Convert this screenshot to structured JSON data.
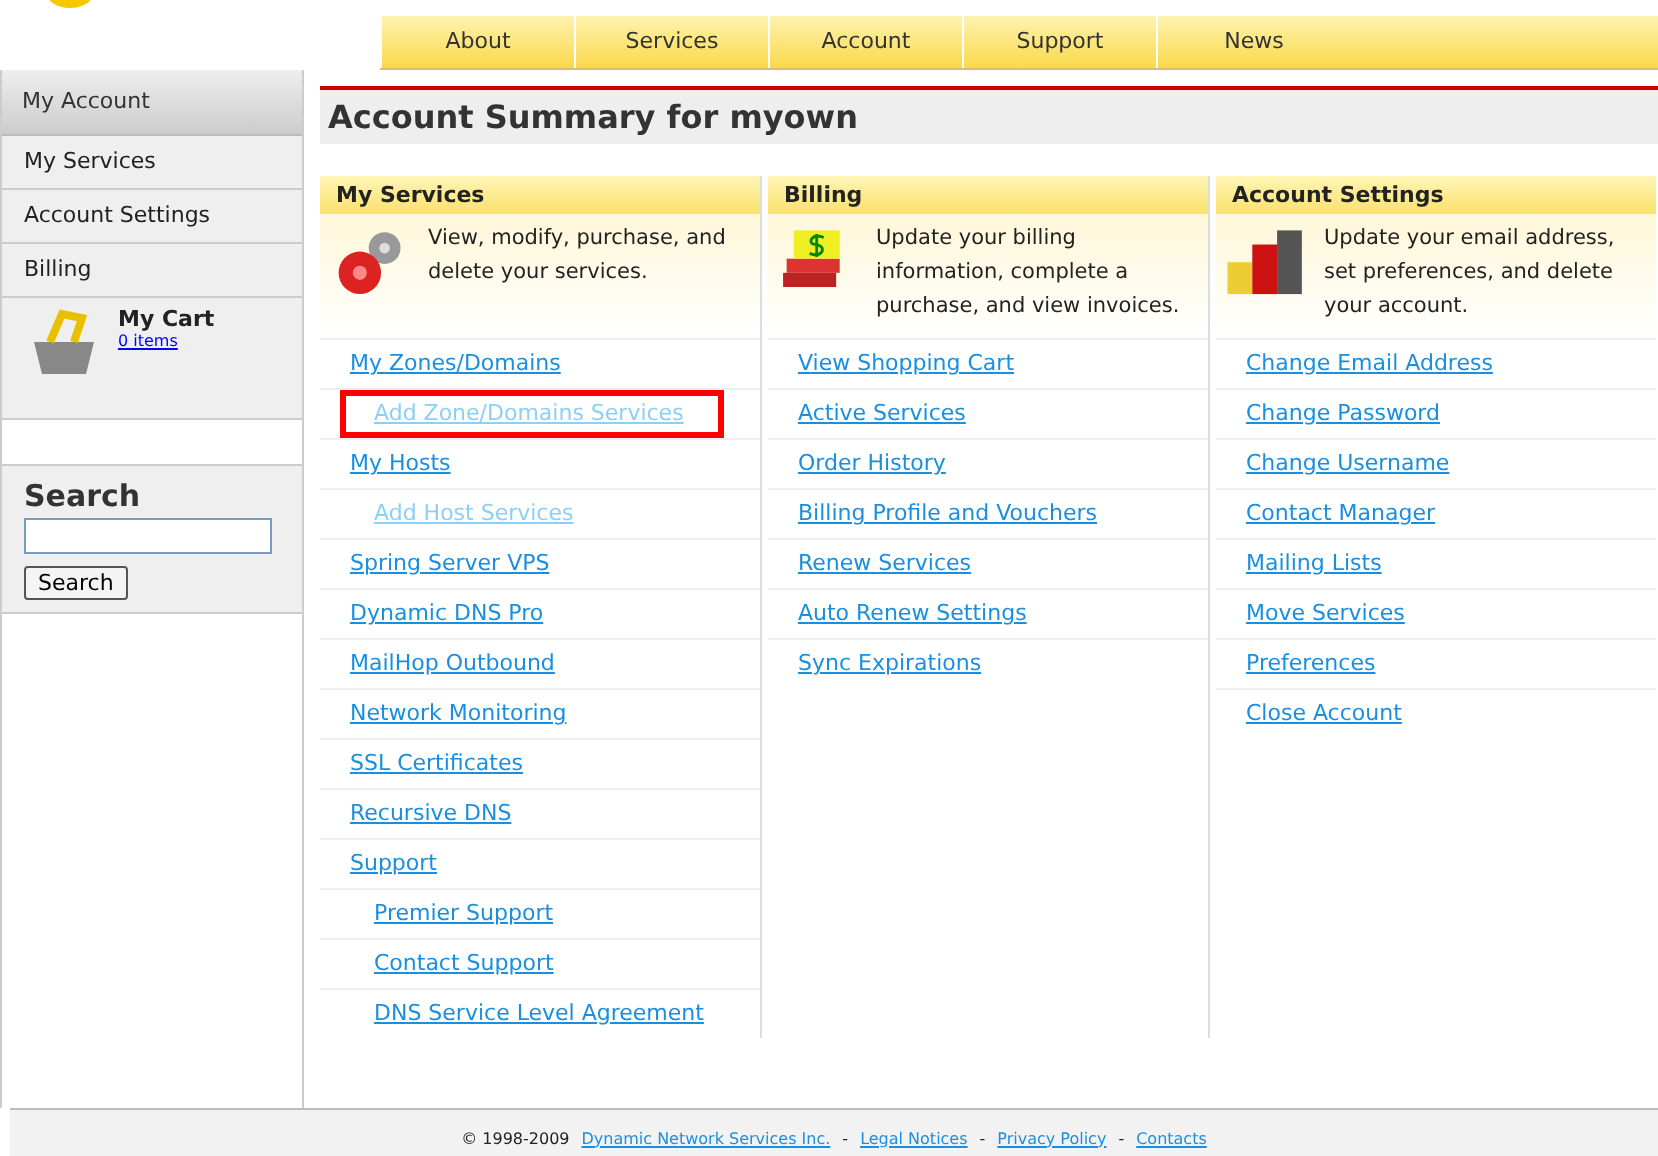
{
  "nav": {
    "items": [
      {
        "label": "About"
      },
      {
        "label": "Services"
      },
      {
        "label": "Account"
      },
      {
        "label": "Support"
      },
      {
        "label": "News"
      }
    ]
  },
  "sidebar": {
    "header": "My Account",
    "items": [
      {
        "label": "My Services"
      },
      {
        "label": "Account Settings"
      },
      {
        "label": "Billing"
      }
    ],
    "cart": {
      "title": "My Cart",
      "link": "0 items"
    }
  },
  "search": {
    "title": "Search",
    "button": "Search"
  },
  "page_title": "Account Summary for myown",
  "panels": [
    {
      "kind": "gears",
      "title": "My Services",
      "description": "View, modify, purchase, and delete your services.",
      "links": [
        {
          "label": "My Zones/Domains",
          "disabled": false,
          "children": [
            {
              "label": "Add Zone/Domains Services",
              "disabled": true,
              "highlighted": true
            }
          ]
        },
        {
          "label": "My Hosts",
          "disabled": false,
          "children": [
            {
              "label": "Add Host Services",
              "disabled": true
            }
          ]
        },
        {
          "label": "Spring Server VPS",
          "disabled": false
        },
        {
          "label": "Dynamic DNS Pro",
          "disabled": false
        },
        {
          "label": "MailHop Outbound",
          "disabled": false
        },
        {
          "label": "Network Monitoring",
          "disabled": false
        },
        {
          "label": "SSL Certificates",
          "disabled": false
        },
        {
          "label": "Recursive DNS",
          "disabled": false
        },
        {
          "label": "Support",
          "disabled": false,
          "children": [
            {
              "label": "Premier Support",
              "disabled": false
            },
            {
              "label": "Contact Support",
              "disabled": false
            },
            {
              "label": "DNS Service Level Agreement",
              "disabled": false
            }
          ]
        }
      ]
    },
    {
      "kind": "books",
      "title": "Billing",
      "description": "Update your billing information, complete a purchase, and view invoices.",
      "links": [
        {
          "label": "View Shopping Cart",
          "disabled": false
        },
        {
          "label": "Active Services",
          "disabled": false
        },
        {
          "label": "Order History",
          "disabled": false
        },
        {
          "label": "Billing Profile and Vouchers",
          "disabled": false
        },
        {
          "label": "Renew Services",
          "disabled": false
        },
        {
          "label": "Auto Renew Settings",
          "disabled": false
        },
        {
          "label": "Sync Expirations",
          "disabled": false
        }
      ]
    },
    {
      "kind": "bars",
      "title": "Account Settings",
      "description": "Update your email address, set preferences, and delete your account.",
      "links": [
        {
          "label": "Change Email Address",
          "disabled": false
        },
        {
          "label": "Change Password",
          "disabled": false
        },
        {
          "label": "Change Username",
          "disabled": false
        },
        {
          "label": "Contact Manager",
          "disabled": false
        },
        {
          "label": "Mailing Lists",
          "disabled": false
        },
        {
          "label": "Move Services",
          "disabled": false
        },
        {
          "label": "Preferences",
          "disabled": false
        },
        {
          "label": "Close Account",
          "disabled": false
        }
      ]
    }
  ],
  "footer": {
    "copyright": "© 1998-2009",
    "links": [
      "Dynamic Network Services Inc.",
      "Legal Notices",
      "Privacy Policy",
      "Contacts"
    ],
    "separator": "-"
  }
}
